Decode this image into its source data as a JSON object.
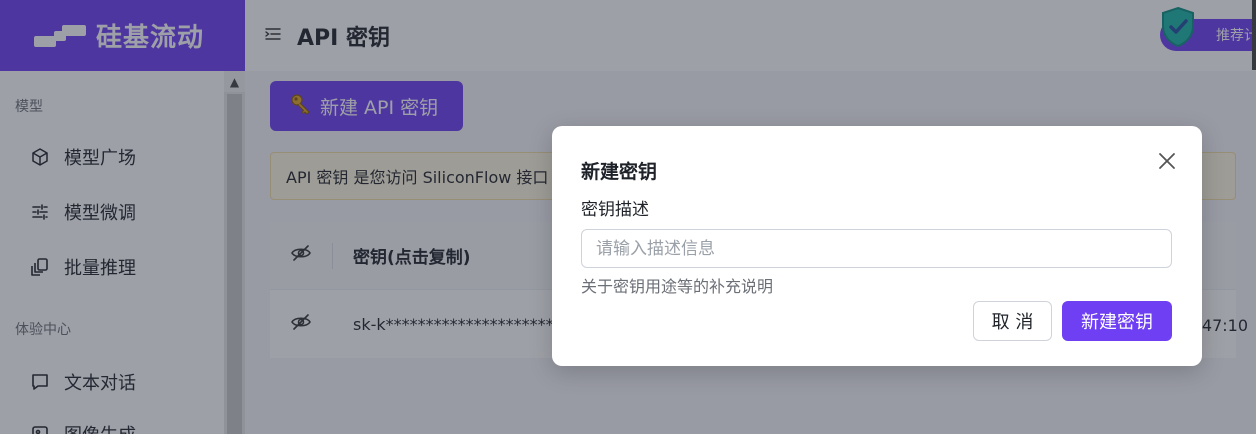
{
  "brand": {
    "name": "硅基流动",
    "accent": "#6e3ff3"
  },
  "sidebar": {
    "sections": [
      {
        "title": "模型",
        "items": [
          {
            "label": "模型广场",
            "icon": "cube-icon"
          },
          {
            "label": "模型微调",
            "icon": "sliders-icon"
          },
          {
            "label": "批量推理",
            "icon": "layers-icon"
          }
        ]
      },
      {
        "title": "体验中心",
        "items": [
          {
            "label": "文本对话",
            "icon": "chat-icon"
          },
          {
            "label": "图像生成",
            "icon": "image-icon"
          }
        ]
      }
    ]
  },
  "header": {
    "title": "API 密钥",
    "recommend_label": "推荐计划"
  },
  "main": {
    "new_key_button": "新建 API 密钥",
    "notice": "API 密钥 是您访问 SiliconFlow 接口",
    "table": {
      "header_key": "密钥(点击复制)",
      "rows": [
        {
          "key": "sk-k************************",
          "time": ":47:10"
        }
      ]
    }
  },
  "modal": {
    "title": "新建密钥",
    "field_label": "密钥描述",
    "field_placeholder": "请输入描述信息",
    "field_value": "",
    "help_text": "关于密钥用途等的补充说明",
    "cancel_label": "取 消",
    "create_label": "新建密钥"
  }
}
